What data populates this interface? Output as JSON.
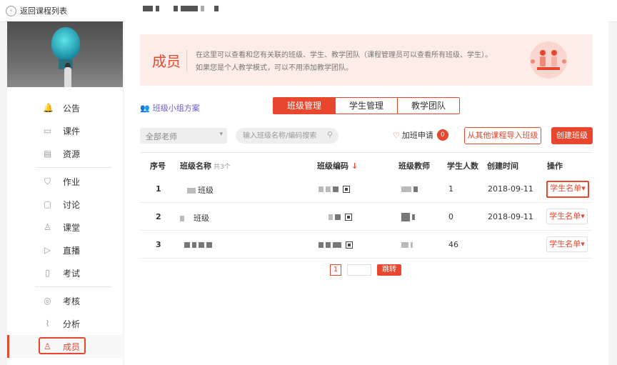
{
  "topbar": {
    "back_label": "返回课程列表",
    "back_icon": "chevron-left-circle-icon"
  },
  "sidebar": {
    "groups": [
      [
        {
          "label": "公告",
          "icon": "bell-icon",
          "glyph": "🔔"
        },
        {
          "label": "课件",
          "icon": "book-icon",
          "glyph": "▭"
        },
        {
          "label": "资源",
          "icon": "folder-icon",
          "glyph": "▤"
        }
      ],
      [
        {
          "label": "作业",
          "icon": "shield-icon",
          "glyph": "⛉"
        },
        {
          "label": "讨论",
          "icon": "chat-icon",
          "glyph": "▢"
        },
        {
          "label": "课堂",
          "icon": "person-icon",
          "glyph": "♙"
        },
        {
          "label": "直播",
          "icon": "play-icon",
          "glyph": "▷"
        },
        {
          "label": "考试",
          "icon": "exam-icon",
          "glyph": "▯"
        }
      ],
      [
        {
          "label": "考核",
          "icon": "search-doc-icon",
          "glyph": "◎"
        },
        {
          "label": "分析",
          "icon": "chart-icon",
          "glyph": "⌇"
        },
        {
          "label": "成员",
          "icon": "member-icon",
          "glyph": "♙",
          "active": true
        }
      ]
    ],
    "accent": "#e8472e"
  },
  "hero": {
    "title": "成员",
    "line1": "在这里可以查看和您有关联的班级、学生、教学团队（课程管理员可以查看所有班级、学生）。",
    "line2": "如果您是个人教学模式，可以不用添加教学团队。"
  },
  "toolbar": {
    "plan_label": "班级小组方案",
    "tabs": [
      {
        "label": "班级管理",
        "active": true
      },
      {
        "label": "学生管理",
        "active": false
      },
      {
        "label": "教学团队",
        "active": false
      }
    ],
    "teacher_select": "全部老师",
    "search_placeholder": "输入班级名称/编码搜索",
    "apply_label": "加班申请",
    "apply_count": "0",
    "import_label": "从其他课程导入班级",
    "create_label": "创建班级"
  },
  "table": {
    "headers": {
      "index": "序号",
      "name": "班级名称",
      "total": "共3个",
      "code": "班级编码",
      "teacher": "班级教师",
      "students": "学生人数",
      "created": "创建时间",
      "action": "操作"
    },
    "rows": [
      {
        "index": "1",
        "name_suffix": "班级",
        "students": "1",
        "created": "2018-09-11",
        "action": "学生名单▾"
      },
      {
        "index": "2",
        "name_suffix": "班级",
        "students": "0",
        "created": "2018-09-11",
        "action": "学生名单▾"
      },
      {
        "index": "3",
        "name_suffix": "",
        "students": "46",
        "created": "",
        "action": "学生名单▾"
      }
    ]
  },
  "pager": {
    "current": "1",
    "jump_label": "跳转"
  }
}
